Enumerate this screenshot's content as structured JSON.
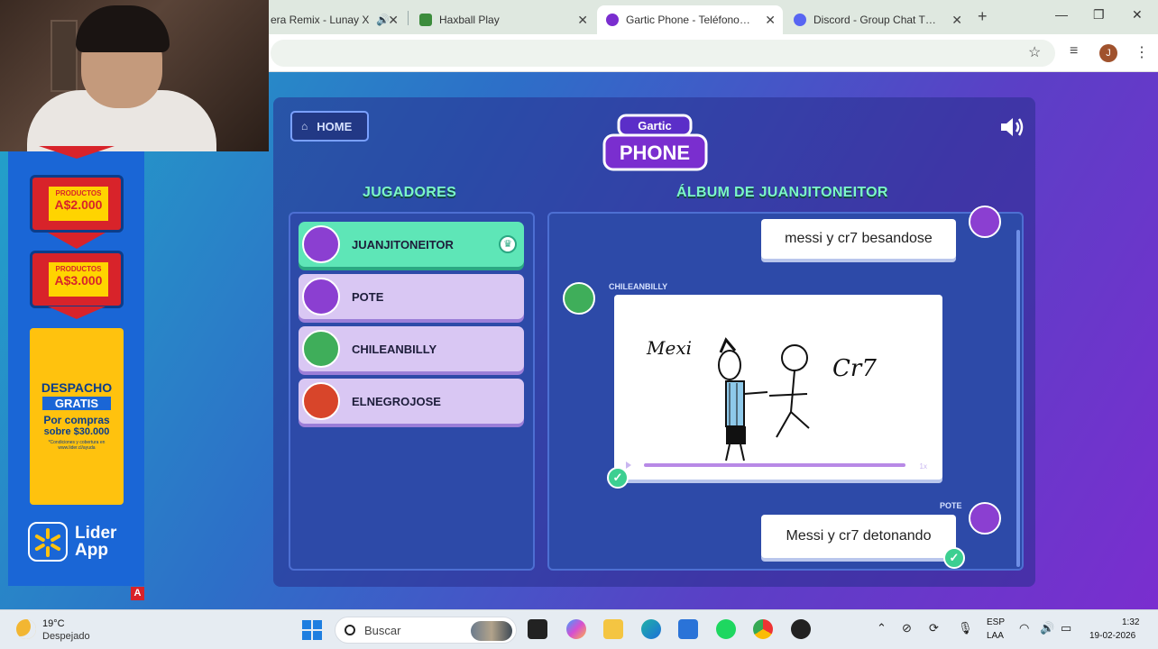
{
  "browser": {
    "tabs": [
      {
        "label": "era Remix - Lunay X",
        "icon": "audio-icon",
        "color": "#ff0000"
      },
      {
        "label": "Haxball Play",
        "icon": "haxball-icon",
        "color": "#3c8c3c"
      },
      {
        "label": "Gartic Phone - Teléfono Des",
        "icon": "phone-icon",
        "color": "#7a2ecf"
      },
      {
        "label": "Discord - Group Chat That's",
        "icon": "discord-icon",
        "color": "#5865f2"
      }
    ],
    "new_tab": "+",
    "profile_initial": "J"
  },
  "ad": {
    "promo1": {
      "small": "PRODUCTOS",
      "big": "A$2.000"
    },
    "promo2": {
      "small": "PRODUCTOS",
      "big": "A$3.000"
    },
    "despacho": "DESPACHO",
    "gratis": "GRATIS",
    "por_compras": "Por compras",
    "sobre": "sobre $30.000",
    "fine_print": "*Condiciones y cobertura en www.lider.cl/ayuda",
    "lider_line1": "Lider",
    "lider_line2": "App",
    "badge": "A"
  },
  "game": {
    "home_label": "HOME",
    "logo_top": "Gartic",
    "logo_main": "PHONE",
    "players_title": "JUGADORES",
    "album_title": "ÁLBUM DE JUANJITONEITOR",
    "players": [
      {
        "name": "JUANJITONEITOR",
        "host": true,
        "avatar_color": "#8b3fd1"
      },
      {
        "name": "POTE",
        "host": false,
        "avatar_color": "#8b3fd1"
      },
      {
        "name": "CHILEANBILLY",
        "host": false,
        "avatar_color": "#3fae5a"
      },
      {
        "name": "ELNEGROJOSE",
        "host": false,
        "avatar_color": "#d8452a"
      }
    ],
    "album": {
      "message1": "messi y cr7 besandose",
      "drawer_name": "CHILEANBILLY",
      "drawing_words": [
        "Mexi",
        "Cr7"
      ],
      "player_speed": "1x",
      "responder_name": "POTE",
      "message2": "Messi y cr7 detonando"
    }
  },
  "taskbar": {
    "temperature": "19°C",
    "condition": "Despejado",
    "search_placeholder": "Buscar",
    "lang1": "ESP",
    "lang2": "LAA",
    "time": "1:32",
    "date": "19-02-2026"
  }
}
